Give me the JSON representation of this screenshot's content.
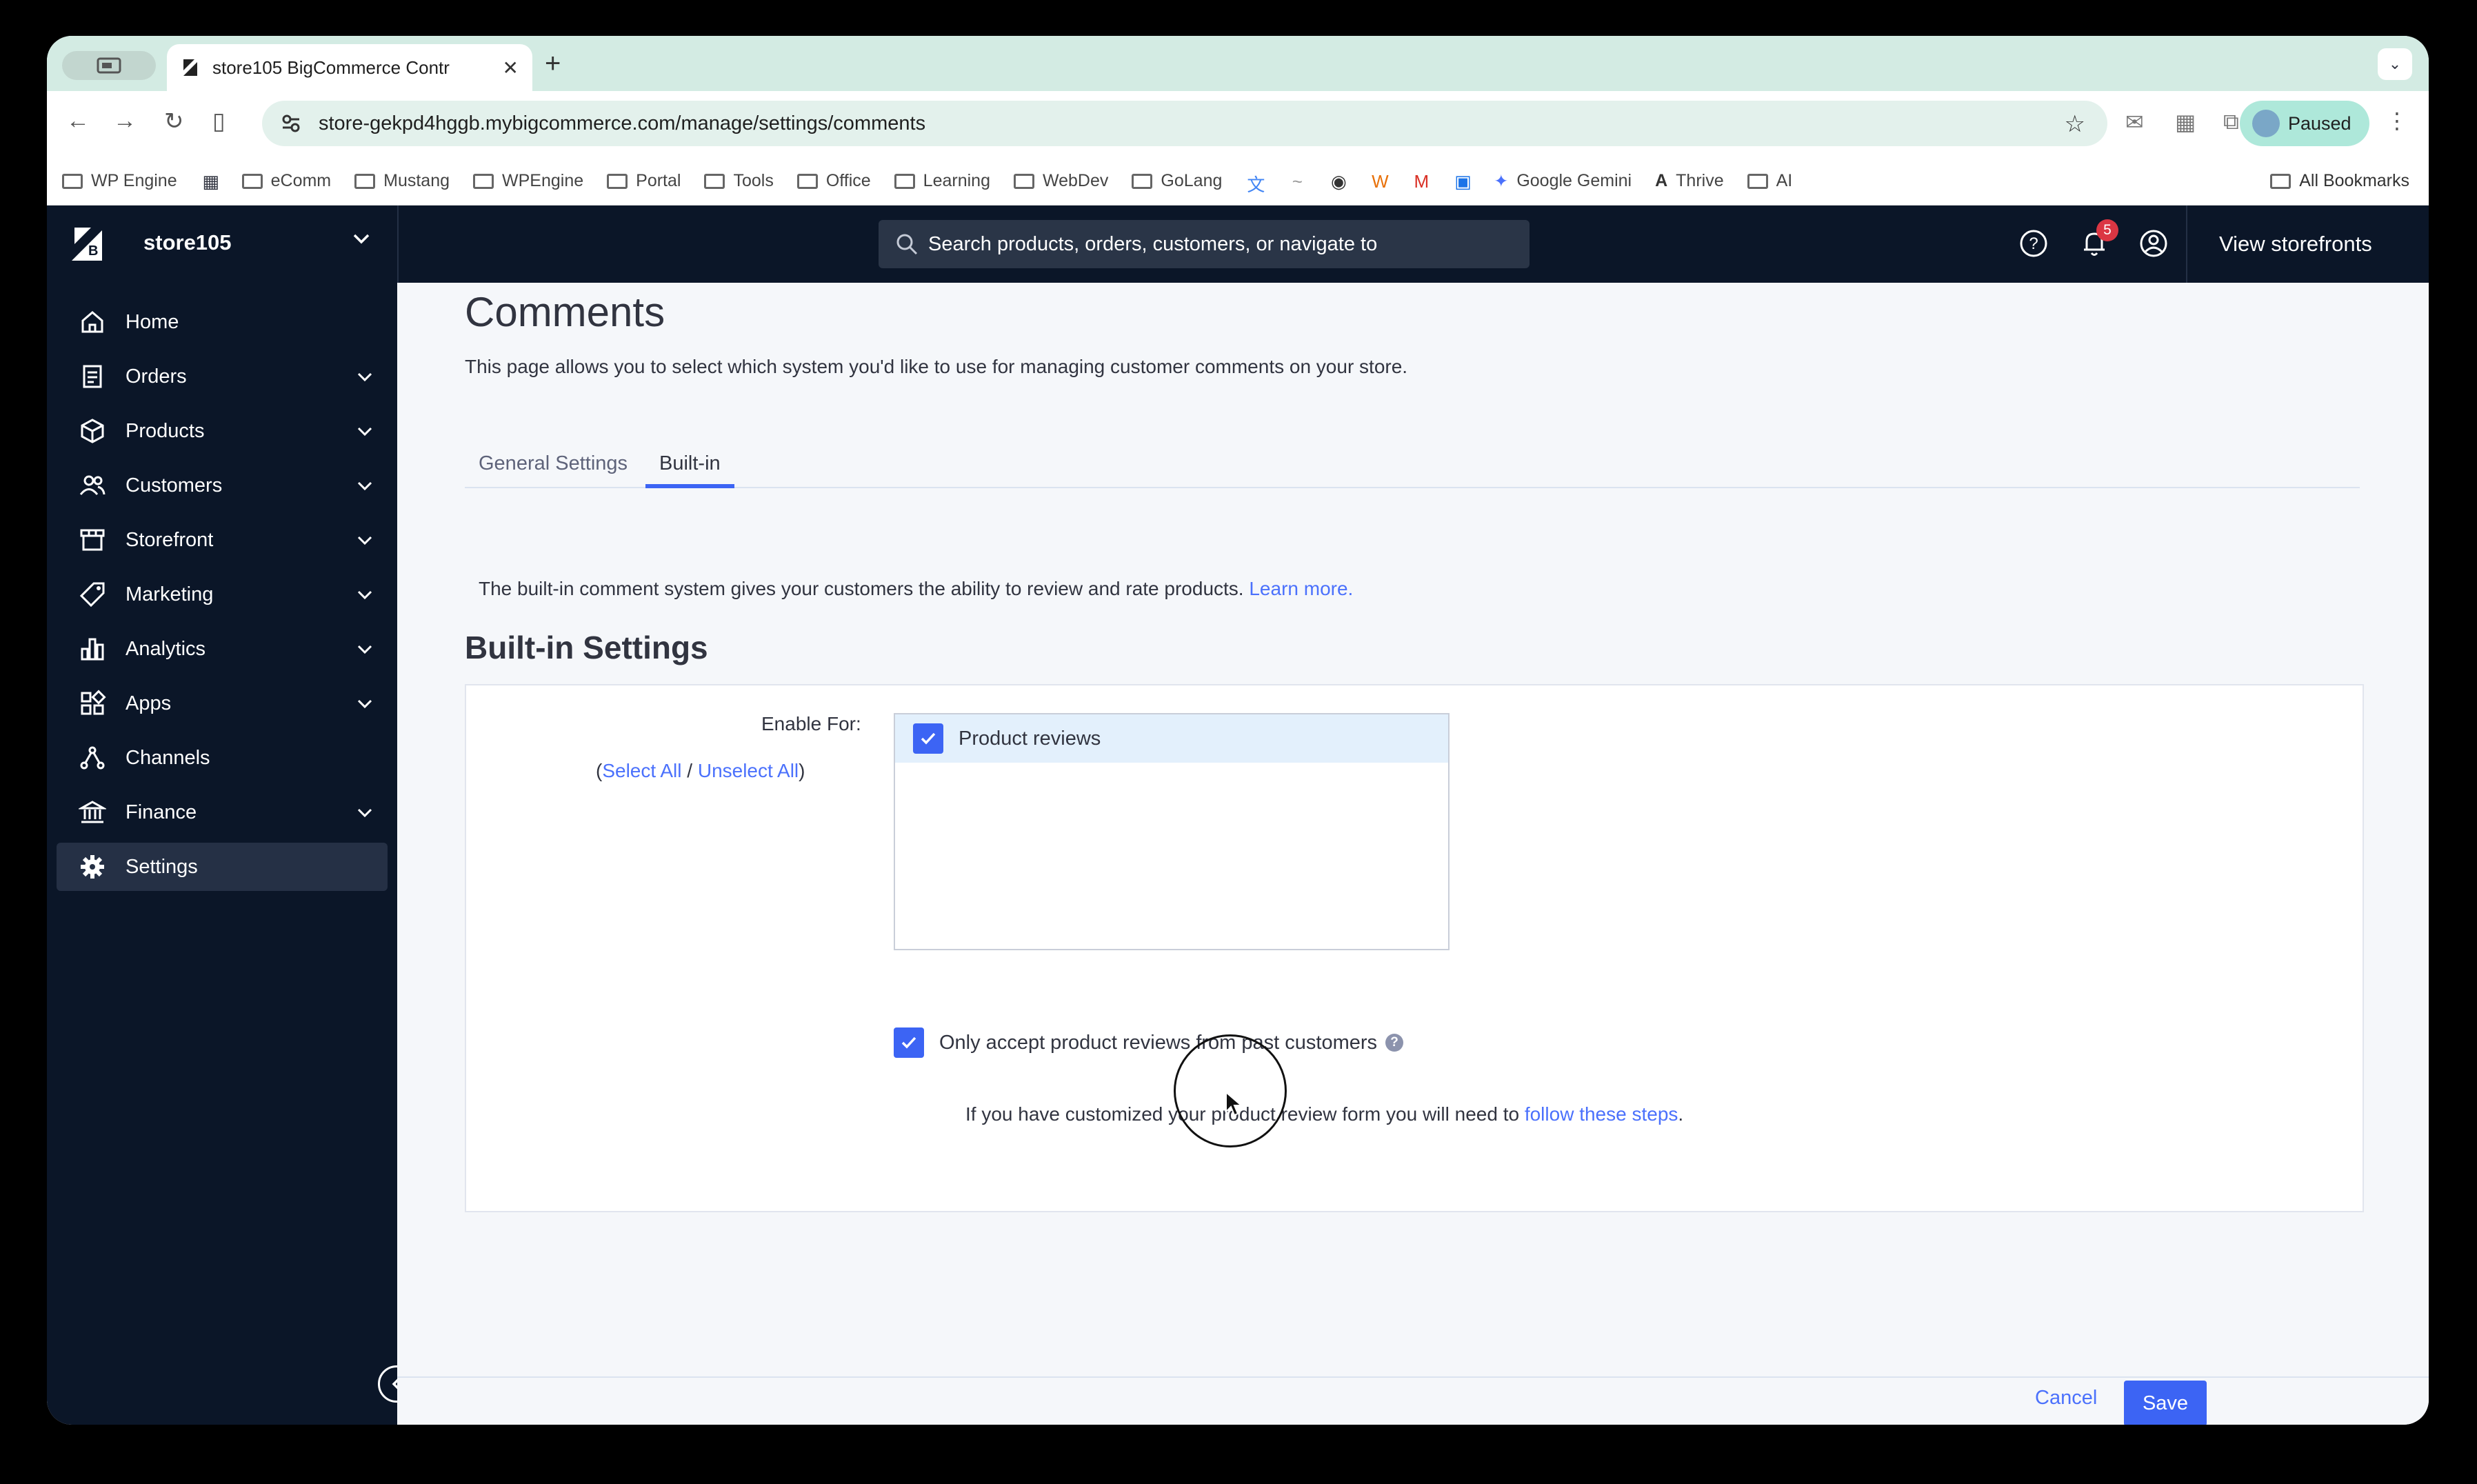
{
  "browser": {
    "tab_title": "store105 BigCommerce Contr",
    "url": "store-gekpd4hggb.mybigcommerce.com/manage/settings/comments",
    "profile_label": "Paused",
    "bookmarks": [
      "WP Engine",
      "eComm",
      "Mustang",
      "WPEngine",
      "Portal",
      "Tools",
      "Office",
      "Learning",
      "WebDev",
      "GoLang",
      "Google Gemini",
      "Thrive",
      "AI"
    ],
    "all_bookmarks": "All Bookmarks"
  },
  "header": {
    "store_name": "store105",
    "search_placeholder": "Search products, orders, customers, or navigate to",
    "notification_count": "5",
    "view_storefronts": "View storefronts"
  },
  "sidebar": {
    "items": [
      {
        "label": "Home",
        "icon": "home-icon",
        "expandable": false
      },
      {
        "label": "Orders",
        "icon": "orders-icon",
        "expandable": true
      },
      {
        "label": "Products",
        "icon": "box-icon",
        "expandable": true
      },
      {
        "label": "Customers",
        "icon": "customers-icon",
        "expandable": true
      },
      {
        "label": "Storefront",
        "icon": "storefront-icon",
        "expandable": true
      },
      {
        "label": "Marketing",
        "icon": "tag-icon",
        "expandable": true
      },
      {
        "label": "Analytics",
        "icon": "bar-chart-icon",
        "expandable": true
      },
      {
        "label": "Apps",
        "icon": "apps-icon",
        "expandable": true
      },
      {
        "label": "Channels",
        "icon": "channels-icon",
        "expandable": false
      },
      {
        "label": "Finance",
        "icon": "bank-icon",
        "expandable": true
      },
      {
        "label": "Settings",
        "icon": "gear-icon",
        "expandable": false,
        "active": true
      }
    ]
  },
  "main": {
    "title": "Comments",
    "description": "This page allows you to select which system you'd like to use for managing customer comments on your store.",
    "tabs": [
      {
        "label": "General Settings",
        "active": false
      },
      {
        "label": "Built-in",
        "active": true
      }
    ],
    "intro_text": "The built-in comment system gives your customers the ability to review and rate products.",
    "intro_link": "Learn more.",
    "section_title": "Built-in Settings",
    "enable_for_label": "Enable For:",
    "select_all": "Select All",
    "unselect_all": "Unselect All",
    "list_options": [
      {
        "label": "Product reviews",
        "checked": true
      }
    ],
    "only_past_customers_label": "Only accept product reviews from past customers",
    "only_past_customers_checked": true,
    "customized_text": "If you have customized your product review form you will need to",
    "customized_link": "follow these steps",
    "period": "."
  },
  "footer": {
    "cancel": "Cancel",
    "save": "Save"
  },
  "colors": {
    "header_bg": "#0b1628",
    "accent": "#3c64f4",
    "link": "#4b71fc",
    "badge": "#db3643"
  }
}
